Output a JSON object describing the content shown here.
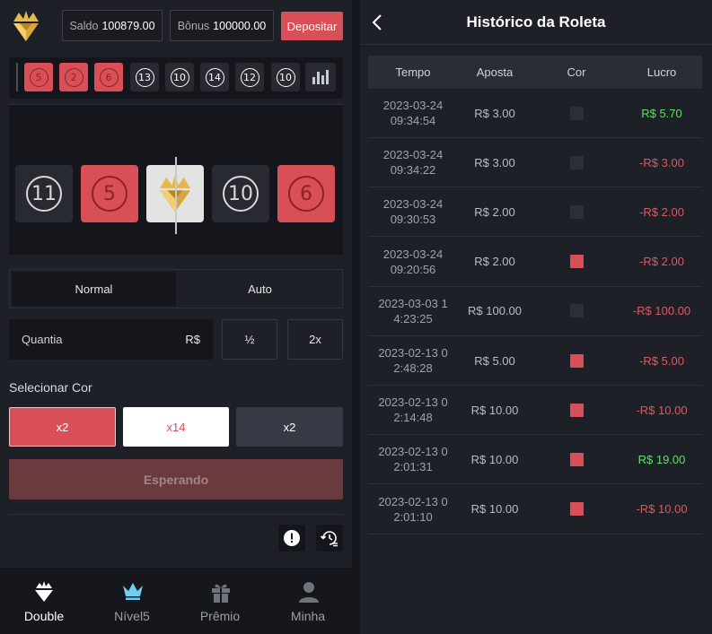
{
  "header": {
    "saldo_label": "Saldo",
    "saldo_value": "100879.00",
    "bonus_label": "Bônus",
    "bonus_value": "100000.00",
    "deposit_label": "Depositar"
  },
  "recent_results": [
    {
      "num": "5",
      "color": "red"
    },
    {
      "num": "2",
      "color": "red"
    },
    {
      "num": "6",
      "color": "red"
    },
    {
      "num": "13",
      "color": "dark"
    },
    {
      "num": "10",
      "color": "dark"
    },
    {
      "num": "14",
      "color": "dark"
    },
    {
      "num": "12",
      "color": "dark"
    },
    {
      "num": "10",
      "color": "dark"
    }
  ],
  "wheel": {
    "tiles": [
      {
        "num": "11",
        "color": "dark"
      },
      {
        "num": "5",
        "color": "red"
      },
      {
        "num": "",
        "color": "white",
        "icon": "crown-diamond-icon"
      },
      {
        "num": "10",
        "color": "dark"
      },
      {
        "num": "6",
        "color": "red"
      }
    ]
  },
  "modes": {
    "normal": "Normal",
    "auto": "Auto"
  },
  "amount": {
    "placeholder": "Quantia",
    "currency": "R$",
    "half": "½",
    "double": "2x"
  },
  "select_color": {
    "label": "Selecionar Cor",
    "red": "x2",
    "white": "x14",
    "black": "x2"
  },
  "wait_button": "Esperando",
  "nav": {
    "double": "Double",
    "nivel": "Nível5",
    "premio": "Prêmio",
    "minha": "Minha"
  },
  "colors": {
    "red": "#d94f58",
    "gold": "#e6b84a",
    "active_nav": "#ffffff",
    "cyan": "#6ed0f0"
  },
  "history": {
    "title": "Histórico da Roleta",
    "columns": [
      "Tempo",
      "Aposta",
      "Cor",
      "Lucro"
    ],
    "rows": [
      {
        "time1": "2023-03-24",
        "time2": "09:34:54",
        "bet": "R$ 3.00",
        "color": "dark",
        "profit": "R$ 5.70",
        "positive": true
      },
      {
        "time1": "2023-03-24",
        "time2": "09:34:22",
        "bet": "R$ 3.00",
        "color": "dark",
        "profit": "-R$ 3.00",
        "positive": false
      },
      {
        "time1": "2023-03-24",
        "time2": "09:30:53",
        "bet": "R$ 2.00",
        "color": "dark",
        "profit": "-R$ 2.00",
        "positive": false
      },
      {
        "time1": "2023-03-24",
        "time2": "09:20:56",
        "bet": "R$ 2.00",
        "color": "red",
        "profit": "-R$ 2.00",
        "positive": false
      },
      {
        "time1": "2023-03-03 1",
        "time2": "4:23:25",
        "bet": "R$ 100.00",
        "color": "dark",
        "profit": "-R$ 100.00",
        "positive": false
      },
      {
        "time1": "2023-02-13 0",
        "time2": "2:48:28",
        "bet": "R$ 5.00",
        "color": "red",
        "profit": "-R$ 5.00",
        "positive": false
      },
      {
        "time1": "2023-02-13 0",
        "time2": "2:14:48",
        "bet": "R$ 10.00",
        "color": "red",
        "profit": "-R$ 10.00",
        "positive": false
      },
      {
        "time1": "2023-02-13 0",
        "time2": "2:01:31",
        "bet": "R$ 10.00",
        "color": "red",
        "profit": "R$ 19.00",
        "positive": true
      },
      {
        "time1": "2023-02-13 0",
        "time2": "2:01:10",
        "bet": "R$ 10.00",
        "color": "red",
        "profit": "-R$ 10.00",
        "positive": false
      }
    ]
  }
}
